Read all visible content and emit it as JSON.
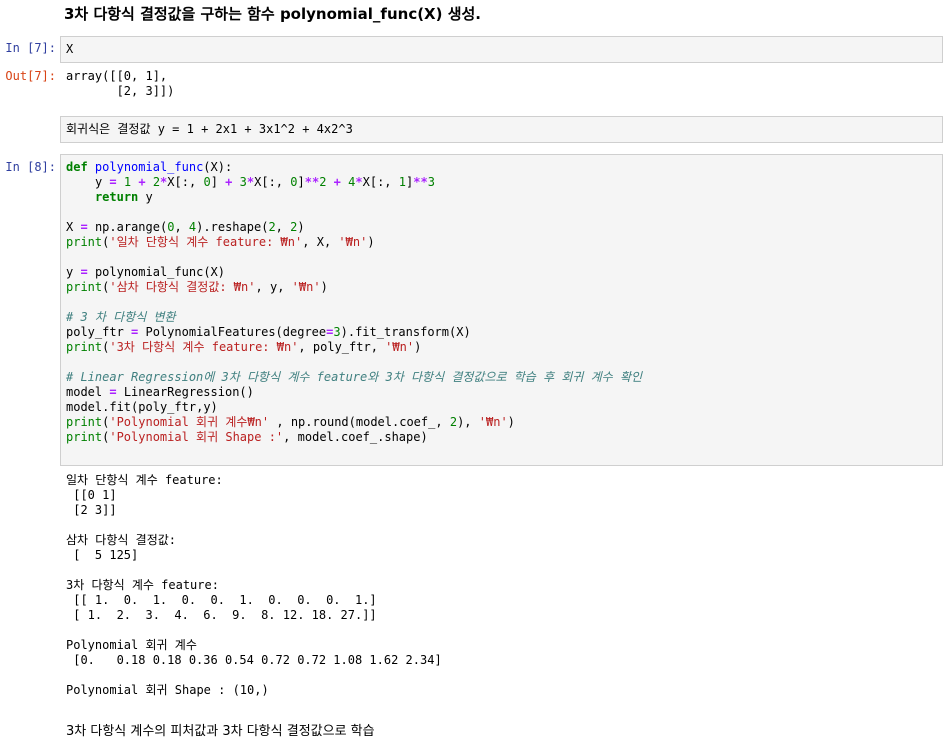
{
  "heading": "3차 다항식 결정값을 구하는 함수 polynomial_func(X) 생성.",
  "cell7": {
    "in_prompt": "In [7]:",
    "code": "X",
    "out_prompt": "Out[7]:",
    "output": "array([[0, 1],\n       [2, 3]])"
  },
  "raw_cell": {
    "text": "회귀식은 결정값 y = 1 + 2x1 + 3x1^2 + 4x2^3"
  },
  "cell8": {
    "in_prompt": "In [8]:",
    "code_lines": [
      "def polynomial_func(X):",
      "    y = 1 + 2*X[:, 0] + 3*X[:, 0]**2 + 4*X[:, 1]**3",
      "    return y",
      "",
      "X = np.arange(0, 4).reshape(2, 2)",
      "print('일차 단항식 계수 feature: ₩n', X, '₩n')",
      "",
      "y = polynomial_func(X)",
      "print('삼차 다항식 결정값: ₩n', y, '₩n')",
      "",
      "# 3 차 다항식 변환",
      "poly_ftr = PolynomialFeatures(degree=3).fit_transform(X)",
      "print('3차 다항식 계수 feature: ₩n', poly_ftr, '₩n')",
      "",
      "# Linear Regression에 3차 다항식 계수 feature와 3차 다항식 결정값으로 학습 후 회귀 계수 확인",
      "model = LinearRegression()",
      "model.fit(poly_ftr,y)",
      "print('Polynomial 회귀 계수₩n' , np.round(model.coef_, 2), '₩n')",
      "print('Polynomial 회귀 Shape :', model.coef_.shape)"
    ],
    "output_lines": [
      "일차 단항식 계수 feature:",
      " [[0 1]",
      " [2 3]]",
      "",
      "삼차 다항식 결정값:",
      " [  5 125]",
      "",
      "3차 다항식 계수 feature:",
      " [[ 1.  0.  1.  0.  0.  1.  0.  0.  0.  1.]",
      " [ 1.  2.  3.  4.  6.  9.  8. 12. 18. 27.]]",
      "",
      "Polynomial 회귀 계수",
      " [0.   0.18 0.18 0.36 0.54 0.72 0.72 1.08 1.62 2.34]",
      "",
      "Polynomial 회귀 Shape : (10,)"
    ]
  },
  "markdown_bottom": "3차 다항식 계수의 피처값과 3차 다항식 결정값으로 학습",
  "colors": {
    "prompt_in": "#303f9f",
    "prompt_out": "#d84315",
    "cell_bg": "#f5f5f5",
    "cell_border": "#cfcfcf",
    "keyword": "#008000",
    "string": "#ba2121",
    "comment": "#408080",
    "operator": "#aa22ff"
  }
}
